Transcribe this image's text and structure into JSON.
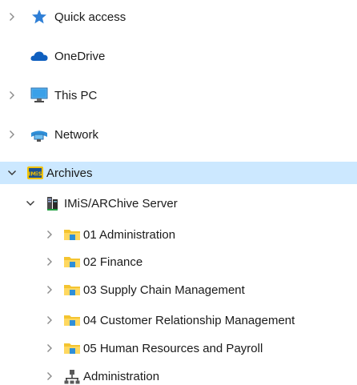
{
  "navigation_pane": {
    "quick_access": {
      "label": "Quick access",
      "icon": "star-icon",
      "expanded": false
    },
    "onedrive": {
      "label": "OneDrive",
      "icon": "cloud-icon"
    },
    "this_pc": {
      "label": "This PC",
      "icon": "monitor-icon",
      "expanded": false
    },
    "network": {
      "label": "Network",
      "icon": "network-icon",
      "expanded": false
    },
    "archives": {
      "label": "Archives",
      "icon": "imis-archive-icon",
      "expanded": true,
      "selected": true,
      "server": {
        "label": "IMiS/ARChive Server",
        "icon": "server-icon",
        "expanded": true,
        "children": [
          {
            "label": "01 Administration",
            "icon": "folder-icon"
          },
          {
            "label": "02 Finance",
            "icon": "folder-icon"
          },
          {
            "label": "03 Supply Chain Management",
            "icon": "folder-icon"
          },
          {
            "label": "04 Customer Relationship Management",
            "icon": "folder-icon"
          },
          {
            "label": "05 Human Resources and Payroll",
            "icon": "folder-icon"
          },
          {
            "label": "Administration",
            "icon": "admin-network-icon"
          }
        ]
      }
    }
  },
  "colors": {
    "selection_bg": "#cce8ff",
    "folder_yellow": "#f4c430",
    "folder_blue": "#2f8fd8",
    "chevron": "#8a8a8a"
  }
}
